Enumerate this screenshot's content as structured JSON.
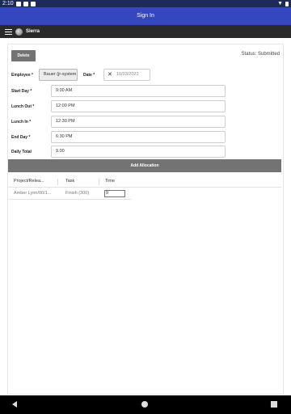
{
  "status_bar": {
    "time": "2:10"
  },
  "header": {
    "title": "Sign In"
  },
  "nav": {
    "title": "Sierra"
  },
  "toolbar": {
    "delete_label": "Delete",
    "status_text": "Status: Submitted"
  },
  "form": {
    "employee_label": "Employee *",
    "employee_value": "Bauer (jr-system",
    "date_label": "Date *",
    "date_value": "10/03/2022",
    "start_day_label": "Start Day *",
    "start_day_value": "9:00 AM",
    "lunch_out_label": "Lunch Out *",
    "lunch_out_value": "12:00 PM",
    "lunch_in_label": "Lunch In *",
    "lunch_in_value": "12:30 PM",
    "end_day_label": "End Day *",
    "end_day_value": "6:30 PM",
    "daily_total_label": "Daily Total",
    "daily_total_value": "9.00"
  },
  "add_allocation_label": "Add Allocation",
  "table": {
    "headers": [
      "Project/Relea...",
      "Task",
      "Time"
    ],
    "rows": [
      {
        "project": "Amber Lynn/00/1...",
        "task": "Finish (300)",
        "time": "9"
      }
    ]
  }
}
